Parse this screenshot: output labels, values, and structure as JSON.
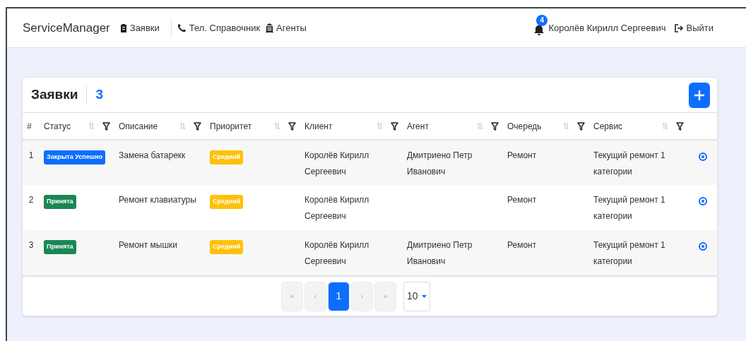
{
  "navbar": {
    "brand": "ServiceManager",
    "links": [
      {
        "kind": "requests",
        "label": "Заявки"
      },
      {
        "kind": "phone",
        "label": "Тел. Справочник"
      },
      {
        "kind": "agents",
        "label": "Агенты"
      }
    ],
    "notifications": "4",
    "user": "Королёв Кирилл Сергеевич",
    "logout": "Выйти"
  },
  "card": {
    "title": "Заявки",
    "count": "3",
    "columns": [
      {
        "label": "#",
        "sortable": false,
        "filterable": false
      },
      {
        "label": "Статус",
        "sortable": true,
        "filterable": true
      },
      {
        "label": "Описание",
        "sortable": true,
        "filterable": true
      },
      {
        "label": "Приоритет",
        "sortable": true,
        "filterable": true
      },
      {
        "label": "Клиент",
        "sortable": true,
        "filterable": true
      },
      {
        "label": "Агент",
        "sortable": true,
        "filterable": true
      },
      {
        "label": "Очередь",
        "sortable": true,
        "filterable": true
      },
      {
        "label": "Сервис",
        "sortable": true,
        "filterable": true
      }
    ],
    "rows": [
      {
        "number": "1",
        "status": {
          "label": "Закрыта Успешно",
          "color": "#0d6efd"
        },
        "description": "Замена батарекк",
        "priority": {
          "label": "Средний",
          "color": "#ffc107"
        },
        "client": "Королёв Кирилл Сергеевич",
        "agent": "Дмитриено Петр Иванович",
        "queue": "Ремонт",
        "service": "Текущий ремонт 1 категории"
      },
      {
        "number": "2",
        "status": {
          "label": "Принята",
          "color": "#198754"
        },
        "description": "Ремонт клавиатуры",
        "priority": {
          "label": "Средний",
          "color": "#ffc107"
        },
        "client": "Королёв Кирилл Сергеевич",
        "queue": "Ремонт",
        "service": "Текущий ремонт 1 категории"
      },
      {
        "number": "3",
        "status": {
          "label": "Принята",
          "color": "#198754"
        },
        "description": "Ремонт мышки",
        "priority": {
          "label": "Средний",
          "color": "#ffc107"
        },
        "client": "Королёв Кирилл Сергеевич",
        "agent": "Дмитриено Петр Иванович",
        "queue": "Ремонт",
        "service": "Текущий ремонт 1 категории"
      }
    ],
    "pagination": {
      "pages": [
        {
          "label": "«",
          "disabled": true,
          "selected": false
        },
        {
          "label": "‹",
          "disabled": true,
          "selected": false
        },
        {
          "label": "1",
          "disabled": false,
          "selected": true
        },
        {
          "label": "›",
          "disabled": true,
          "selected": false
        },
        {
          "label": "»",
          "disabled": true,
          "selected": false
        }
      ],
      "page_size": "10"
    }
  }
}
